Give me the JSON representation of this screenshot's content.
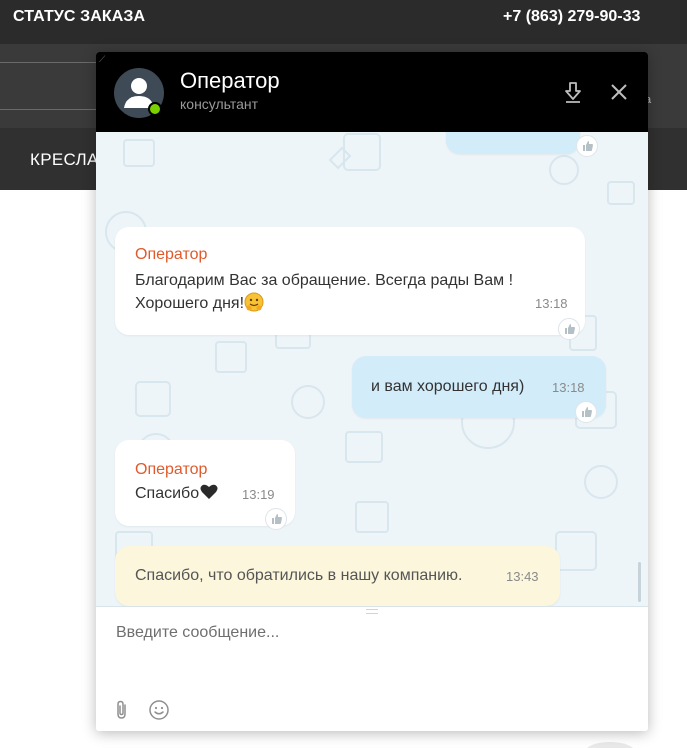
{
  "site": {
    "order_status": "СТАТУС ЗАКАЗА",
    "phone": "+7 (863) 279-90-33",
    "nav_item": "КРЕСЛА",
    "band_text": "а"
  },
  "chat": {
    "operator_name": "Оператор",
    "operator_role": "консультант",
    "online_color": "#7bd000",
    "header_icons": [
      "download-icon",
      "close-icon"
    ],
    "messages": [
      {
        "type": "incoming",
        "author": "Оператор",
        "line1": "Благодарим Вас за обращение. Всегда рады Вам !",
        "line2": "Хорошего дня!",
        "emoji": "hugging-face",
        "time": "13:18"
      },
      {
        "type": "outgoing",
        "text": "и вам хорошего дня)",
        "time": "13:18"
      },
      {
        "type": "incoming",
        "author": "Оператор",
        "text": "Спасибо",
        "emoji": "black-heart",
        "time": "13:19"
      },
      {
        "type": "system",
        "text": "Спасибо, что обратились в нашу компанию.",
        "time": "13:43"
      }
    ],
    "input_placeholder": "Введите сообщение...",
    "input_value": "",
    "footer_icons": [
      "paperclip-icon",
      "smile-icon"
    ]
  }
}
